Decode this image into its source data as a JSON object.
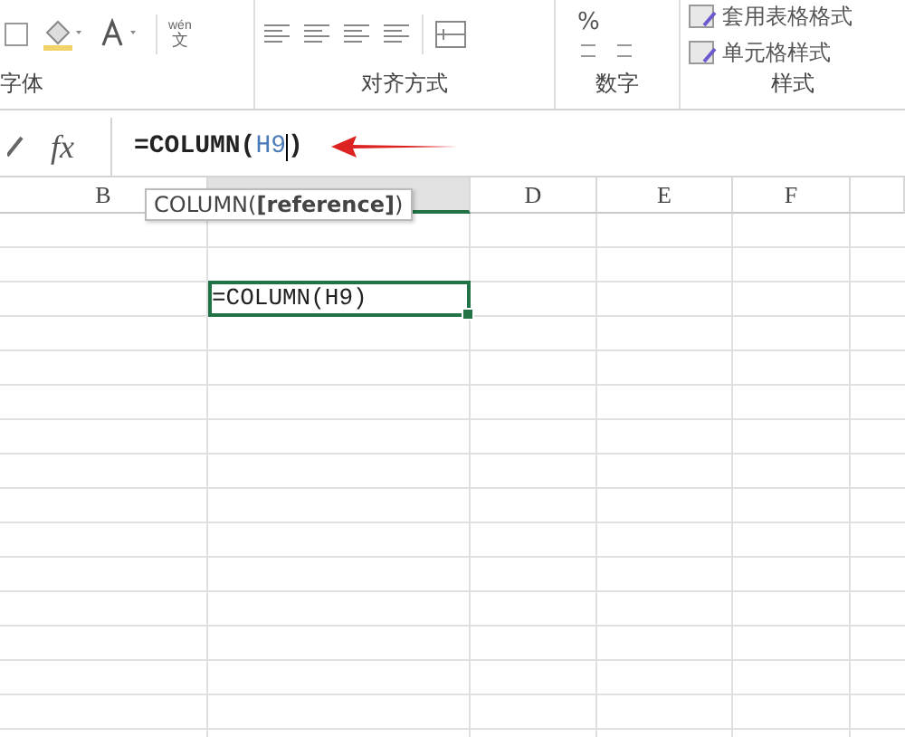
{
  "ribbon": {
    "groups": [
      {
        "kind": "font",
        "label": "字体",
        "phonetic_top": "wén",
        "phonetic_bottom": "文"
      },
      {
        "kind": "align",
        "label": "对齐方式"
      },
      {
        "kind": "number",
        "label": "数字",
        "percent": "%"
      },
      {
        "kind": "styles",
        "label": "样式",
        "items": [
          "套用表格格式",
          "单元格样式"
        ]
      }
    ]
  },
  "formula_bar": {
    "fx": "fx",
    "formula_start": "=COLUMN(",
    "formula_ref": "H9",
    "formula_end": ")"
  },
  "tooltip": "COLUMN(**[reference]**)",
  "columns": [
    {
      "label": "B",
      "selected": false
    },
    {
      "selected": true
    },
    {
      "label": "D",
      "selected": false
    },
    {
      "label": "E",
      "selected": false
    },
    {
      "label": "F",
      "selected": false
    }
  ],
  "active_cell": {
    "value": "=COLUMN(H9)"
  }
}
